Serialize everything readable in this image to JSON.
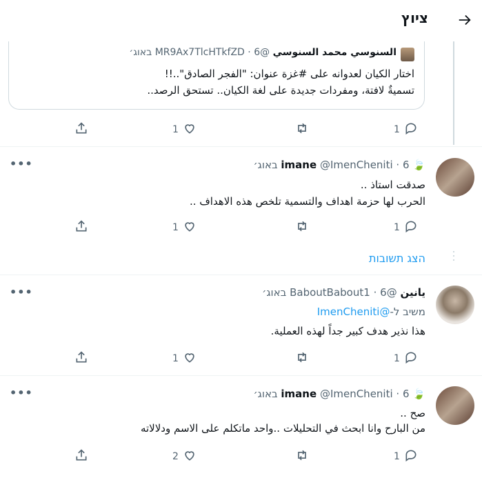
{
  "header": {
    "title": "ציוץ"
  },
  "quote": {
    "name": "السنوسي محمد السنوسي",
    "handle": "@MR9Ax7TlcHTkfZD",
    "sep": "·",
    "date": "6 באוג׳",
    "lines": [
      "اختار الكيان لعدوانه على #غزة عنوان: \"الفجر الصادق\"..!!",
      "تسميةٌ لافتة، ومفردات جديدة على لغة الكيان.. تستحق الرصد.."
    ]
  },
  "tweets": [
    {
      "name": "imane",
      "handle": "@ImenCheniti",
      "sep": "·",
      "date": "6 באוג׳",
      "lines": [
        "صدقت استاذ ..",
        "الحرب لها حزمة اهداف والتسمية تلخص هذه الاهداف .."
      ],
      "reply_count": "1",
      "like_count": "1"
    },
    {
      "name": "يانين",
      "handle": "@BaboutBabout1",
      "sep": "·",
      "date": "6 באוג׳",
      "reply_to_prefix": "משיב ל-",
      "reply_to_handle": "@ImenCheniti",
      "lines": [
        "هذا نذير هدف كبير جداً لهذه العملية."
      ],
      "reply_count": "1",
      "like_count": "1"
    },
    {
      "name": "imane",
      "handle": "@ImenCheniti",
      "sep": "·",
      "date": "6 באוג׳",
      "lines": [
        "صح ..",
        "من البارح وانا ابحث في التحليلات ..واحد ماتكلم على الاسم ودلالاته"
      ],
      "reply_count": "1",
      "like_count": "2"
    }
  ],
  "main_actions": {
    "reply_count": "1",
    "like_count": "1"
  },
  "show_replies": "הצג תשובות",
  "icons": {
    "back": "arrow-right-icon",
    "reply": "reply-icon",
    "retweet": "retweet-icon",
    "like": "heart-icon",
    "share": "share-icon",
    "more": "more-icon",
    "leaf": "leaf-icon"
  }
}
